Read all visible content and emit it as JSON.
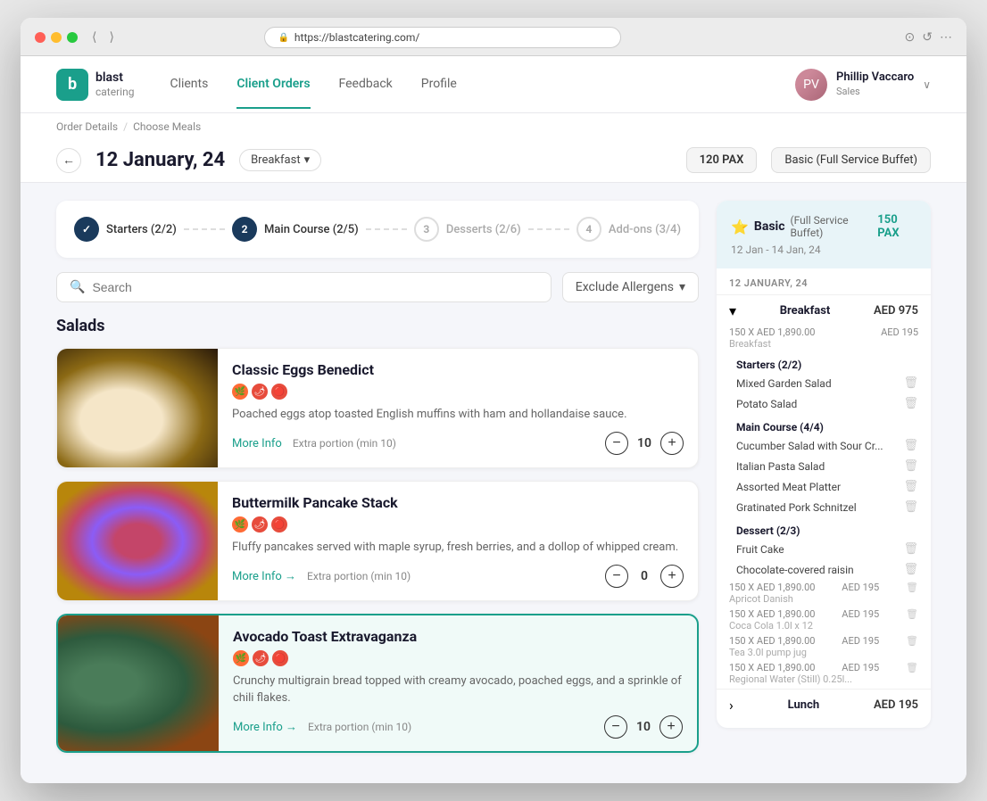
{
  "browser": {
    "url": "https://blastcatering.com/",
    "back": "‹",
    "forward": "›"
  },
  "header": {
    "logo_letter": "b",
    "logo_name": "blast",
    "logo_sub": "catering",
    "nav_items": [
      {
        "label": "Clients",
        "active": false
      },
      {
        "label": "Client Orders",
        "active": true
      },
      {
        "label": "Feedback",
        "active": false
      },
      {
        "label": "Profile",
        "active": false
      }
    ],
    "user_name": "Phillip Vaccaro",
    "user_role": "Sales"
  },
  "breadcrumb": {
    "items": [
      "Order Details",
      "Choose Meals"
    ],
    "separator": "/"
  },
  "date_bar": {
    "date": "12 January, 24",
    "meal_type": "Breakfast",
    "pax": "120 PAX",
    "service": "Basic (Full Service Buffet)"
  },
  "wizard": {
    "steps": [
      {
        "number": "✓",
        "label": "Starters (2/2)",
        "state": "done"
      },
      {
        "number": "2",
        "label": "Main Course (2/5)",
        "state": "active"
      },
      {
        "number": "3",
        "label": "Desserts (2/6)",
        "state": "inactive"
      },
      {
        "number": "4",
        "label": "Add-ons (3/4)",
        "state": "inactive"
      }
    ]
  },
  "search": {
    "placeholder": "Search",
    "allergen_label": "Exclude Allergens"
  },
  "section_label": "Salads",
  "meals": [
    {
      "name": "Classic Eggs Benedict",
      "description": "Poached eggs atop toasted English muffins with ham and hollandaise sauce.",
      "tags": [
        "🔥",
        "🌶",
        "🔴"
      ],
      "more_info": "More Info",
      "portion_label": "Extra portion (min 10)",
      "quantity": "10",
      "selected": false,
      "food_class": "food-eggs"
    },
    {
      "name": "Buttermilk Pancake Stack",
      "description": "Fluffy pancakes served with maple syrup, fresh berries, and a dollop of whipped cream.",
      "tags": [
        "🔥",
        "🌶",
        "🔴"
      ],
      "more_info": "More Info →",
      "portion_label": "Extra portion (min 10)",
      "quantity": "0",
      "selected": false,
      "food_class": "food-pancake"
    },
    {
      "name": "Avocado Toast Extravaganza",
      "description": "Crunchy multigrain bread topped with creamy avocado, poached eggs, and a sprinkle of chili flakes.",
      "tags": [
        "🔥",
        "🌶",
        "🔴"
      ],
      "more_info": "More Info →",
      "portion_label": "Extra portion (min 10)",
      "quantity": "10",
      "selected": true,
      "food_class": "food-avocado"
    }
  ],
  "order_summary": {
    "service_name": "Basic",
    "service_type": "(Full Service Buffet)",
    "pax": "150 PAX",
    "dates": "12 Jan - 14 Jan, 24",
    "date_label": "12 JANUARY, 24",
    "sections": [
      {
        "name": "Breakfast",
        "price": "AED 975",
        "expanded": true,
        "sub_line": "150 X AED 1,890.00    AED 195",
        "sub_desc": "Breakfast",
        "categories": [
          {
            "title": "Starters (2/2)",
            "items": [
              {
                "name": "Mixed Garden Salad",
                "price": ""
              },
              {
                "name": "Potato Salad",
                "price": ""
              }
            ]
          },
          {
            "title": "Main Course (4/4)",
            "items": [
              {
                "name": "Cucumber Salad with Sour Cr...",
                "price": ""
              },
              {
                "name": "Italian Pasta Salad",
                "price": ""
              },
              {
                "name": "Assorted Meat Platter",
                "price": ""
              },
              {
                "name": "Gratinated Pork Schnitzel",
                "price": ""
              }
            ]
          },
          {
            "title": "Dessert (2/3)",
            "items": [
              {
                "name": "Fruit Cake",
                "price": ""
              },
              {
                "name": "Chocolate-covered raisin",
                "price": ""
              }
            ]
          }
        ],
        "extra_items": [
          {
            "qty_price": "150 X AED 1,890.00",
            "price": "AED 195",
            "desc": "Apricot Danish"
          },
          {
            "qty_price": "150 X AED 1,890.00",
            "price": "AED 195",
            "desc": "Coca Cola 1.0l x 12"
          },
          {
            "qty_price": "150 X AED 1,890.00",
            "price": "AED 195",
            "desc": "Tea 3.0l pump jug"
          },
          {
            "qty_price": "150 X AED 1,890.00",
            "price": "AED 195",
            "desc": "Regional Water (Still) 0.25l..."
          }
        ]
      },
      {
        "name": "Lunch",
        "price": "AED 195",
        "expanded": false,
        "categories": []
      }
    ]
  }
}
